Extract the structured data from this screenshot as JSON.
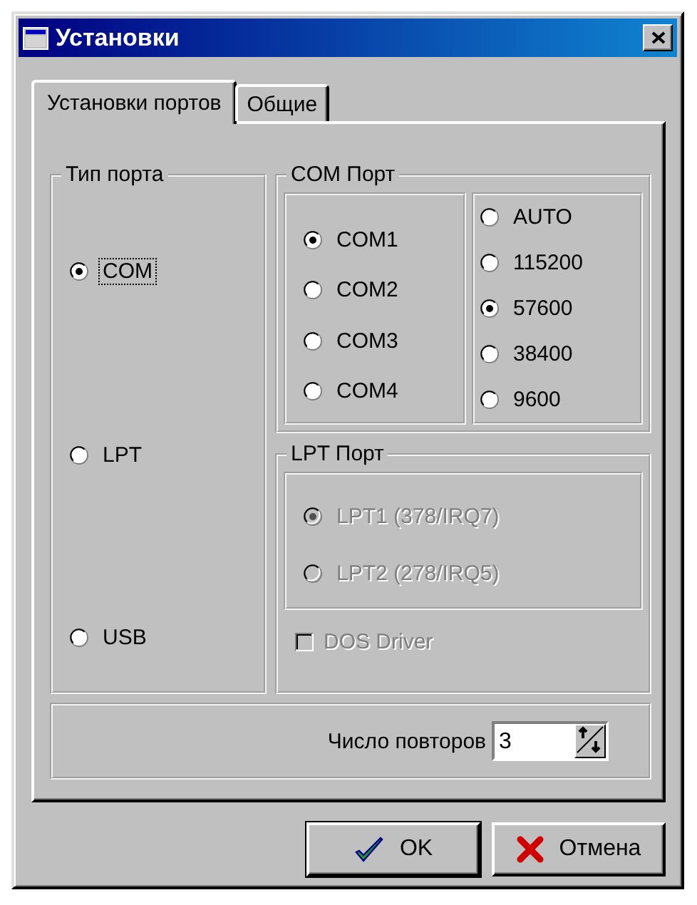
{
  "window": {
    "title": "Установки"
  },
  "tabs": [
    {
      "label": "Установки портов",
      "selected": true
    },
    {
      "label": "Общие",
      "selected": false
    }
  ],
  "port_type": {
    "title": "Тип порта",
    "options": [
      {
        "label": "COM",
        "selected": true,
        "focused": true
      },
      {
        "label": "LPT",
        "selected": false,
        "focused": false
      },
      {
        "label": "USB",
        "selected": false,
        "focused": false
      }
    ]
  },
  "com_port": {
    "title": "COM Порт",
    "ports": [
      {
        "label": "COM1",
        "selected": true
      },
      {
        "label": "COM2",
        "selected": false
      },
      {
        "label": "COM3",
        "selected": false
      },
      {
        "label": "COM4",
        "selected": false
      }
    ],
    "speeds": [
      {
        "label": "AUTO",
        "selected": false
      },
      {
        "label": "115200",
        "selected": false
      },
      {
        "label": "57600",
        "selected": true
      },
      {
        "label": "38400",
        "selected": false
      },
      {
        "label": "9600",
        "selected": false
      }
    ]
  },
  "lpt_port": {
    "title": "LPT Порт",
    "ports": [
      {
        "label": "LPT1 (378/IRQ7)",
        "selected": true,
        "disabled": true
      },
      {
        "label": "LPT2 (278/IRQ5)",
        "selected": false,
        "disabled": true
      }
    ],
    "dos_driver": {
      "label": "DOS Driver",
      "checked": false,
      "disabled": true
    }
  },
  "retries": {
    "label": "Число повторов",
    "value": "3"
  },
  "buttons": [
    {
      "label": "OK",
      "kind": "ok"
    },
    {
      "label": "Отмена",
      "kind": "cancel"
    }
  ]
}
